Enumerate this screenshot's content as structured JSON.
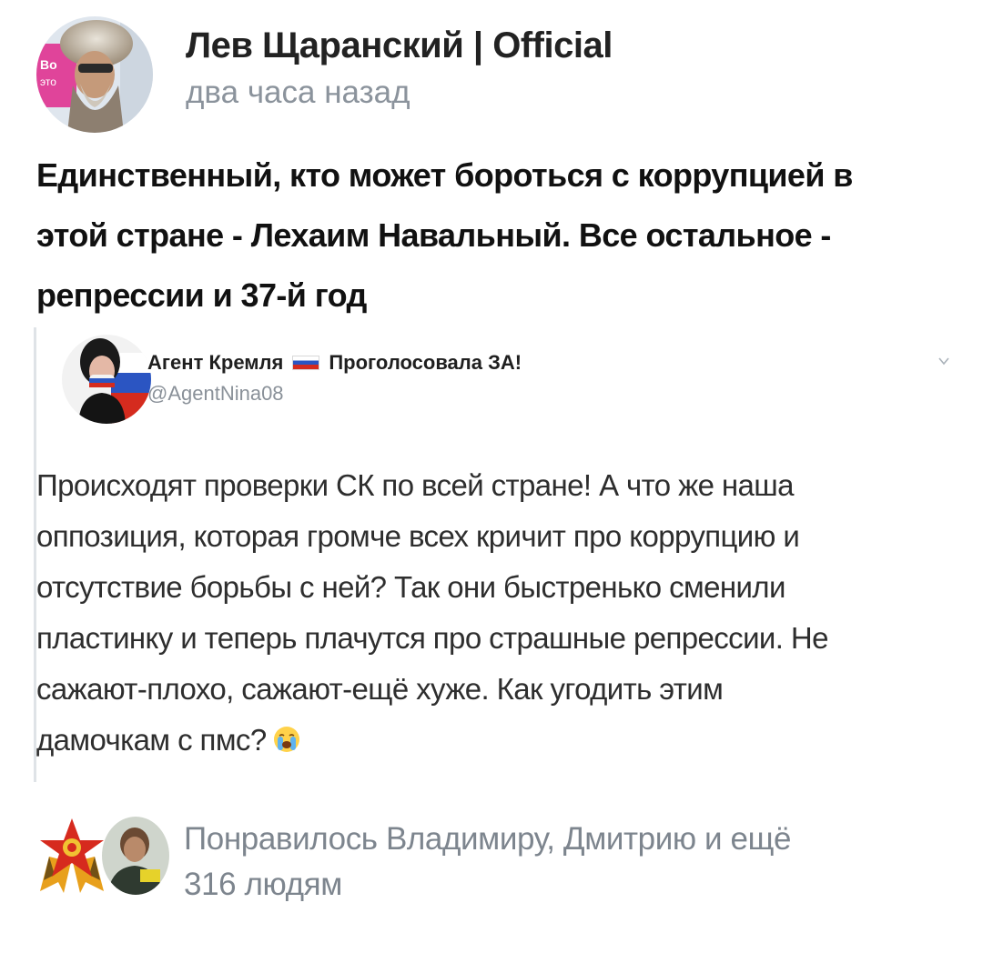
{
  "post": {
    "author_name": "Лев Щаранский | Official",
    "time": "два часа назад",
    "text_lines": [
      "Единственный, кто может бороться с коррупцией в",
      "этой стране - Лехаим Навальный. Все остальное -",
      "репрессии и 37-й год"
    ]
  },
  "embed": {
    "name_part1": "Агент Кремля",
    "name_part2": "Проголосовала ЗА!",
    "handle": "@AgentNina08",
    "text_lines": [
      "Происходят проверки СК по всей стране! А что же наша",
      "оппозиция, которая громче всех кричит про коррупцию и",
      "отсутствие борьбы с ней? Так они быстренько сменили",
      "пластинку и теперь плачутся про страшные репрессии. Не",
      "сажают-плохо, сажают-ещё хуже. Как угодить этим",
      "дамочкам с пмс?"
    ]
  },
  "likes": {
    "lines": [
      "Понравилось Владимиру, Дмитрию и ещё",
      "316 людям"
    ]
  },
  "icons": {
    "flag": "russian-flag-icon",
    "caret": "chevron-down-icon",
    "emoji": "crying-face-emoji-icon",
    "badge": "order-star-badge-icon"
  },
  "colors": {
    "secondary_text": "#8b939c",
    "quote_border": "#dfe3e7"
  }
}
